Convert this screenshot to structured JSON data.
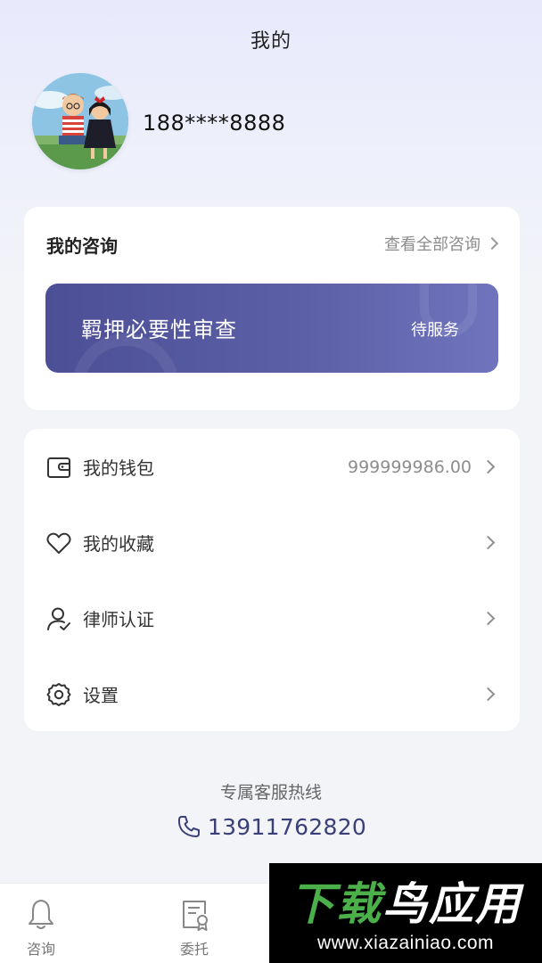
{
  "header": {
    "title": "我的"
  },
  "profile": {
    "phone": "188****8888"
  },
  "consultation": {
    "title": "我的咨询",
    "view_all_label": "查看全部咨询",
    "current": {
      "name": "羁押必要性审查",
      "status": "待服务"
    }
  },
  "menu": {
    "items": [
      {
        "label": "我的钱包",
        "value": "999999986.00",
        "icon": "wallet-icon"
      },
      {
        "label": "我的收藏",
        "value": "",
        "icon": "heart-icon"
      },
      {
        "label": "律师认证",
        "value": "",
        "icon": "user-check-icon"
      },
      {
        "label": "设置",
        "value": "",
        "icon": "gear-icon"
      }
    ]
  },
  "hotline": {
    "label": "专属客服热线",
    "number": "13911762820"
  },
  "bottom_nav": {
    "items": [
      {
        "label": "咨询",
        "icon": "bell-icon"
      },
      {
        "label": "委托",
        "icon": "document-badge-icon"
      }
    ]
  },
  "watermark": {
    "brand_green": "下载",
    "brand_white": "鸟应用",
    "url": "www.xiazainiao.com"
  },
  "colors": {
    "accent": "#4c4f96",
    "background": "#f3f4f8",
    "hotline_text": "#3a3f78",
    "watermark_green": "#4cb04a"
  }
}
